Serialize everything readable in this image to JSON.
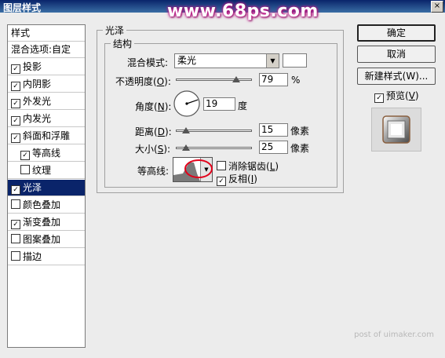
{
  "window": {
    "title": "图层样式",
    "close": "×",
    "watermark": "www.68ps.com"
  },
  "style_list": {
    "header": "样式",
    "items": [
      {
        "label": "混合选项:自定",
        "checkbox": false
      },
      {
        "label": "投影",
        "checkbox": true,
        "checked": true
      },
      {
        "label": "内阴影",
        "checkbox": true,
        "checked": true
      },
      {
        "label": "外发光",
        "checkbox": true,
        "checked": true
      },
      {
        "label": "内发光",
        "checkbox": true,
        "checked": true
      },
      {
        "label": "斜面和浮雕",
        "checkbox": true,
        "checked": true
      },
      {
        "label": "等高线",
        "checkbox": true,
        "checked": true,
        "indent": true
      },
      {
        "label": "纹理",
        "checkbox": true,
        "checked": false,
        "indent": true
      },
      {
        "label": "光泽",
        "checkbox": true,
        "checked": true,
        "selected": true
      },
      {
        "label": "颜色叠加",
        "checkbox": true,
        "checked": false
      },
      {
        "label": "渐变叠加",
        "checkbox": true,
        "checked": true
      },
      {
        "label": "图案叠加",
        "checkbox": true,
        "checked": false
      },
      {
        "label": "描边",
        "checkbox": true,
        "checked": false
      }
    ],
    "check_mark": "✓"
  },
  "panel": {
    "title": "光泽",
    "structure_title": "结构",
    "blend_mode_label": "混合模式:",
    "blend_mode_value": "柔光",
    "blend_color": "#ffffff",
    "opacity_label": "不透明度",
    "opacity_key": "O",
    "opacity_value": "79",
    "opacity_percent": 79,
    "opacity_unit": "%",
    "angle_label": "角度",
    "angle_key": "N",
    "angle_value": "19",
    "angle_degrees": 19,
    "angle_unit": "度",
    "distance_label": "距离",
    "distance_key": "D",
    "distance_value": "15",
    "distance_unit": "像素",
    "size_label": "大小",
    "size_key": "S",
    "size_value": "25",
    "size_unit": "像素",
    "contour_label": "等高线:",
    "antialias_label": "消除锯齿",
    "antialias_key": "L",
    "antialias_checked": false,
    "invert_label": "反相",
    "invert_key": "I",
    "invert_checked": true
  },
  "buttons": {
    "ok": "确定",
    "cancel": "取消",
    "new_style": "新建样式(W)...",
    "preview_label": "预览",
    "preview_key": "V",
    "preview_checked": true
  },
  "footer": "post of uimaker.com",
  "colors": {
    "highlight": "#0a246a",
    "annotation_circle": "#e2001a",
    "watermark_glow": "#c2178a"
  }
}
